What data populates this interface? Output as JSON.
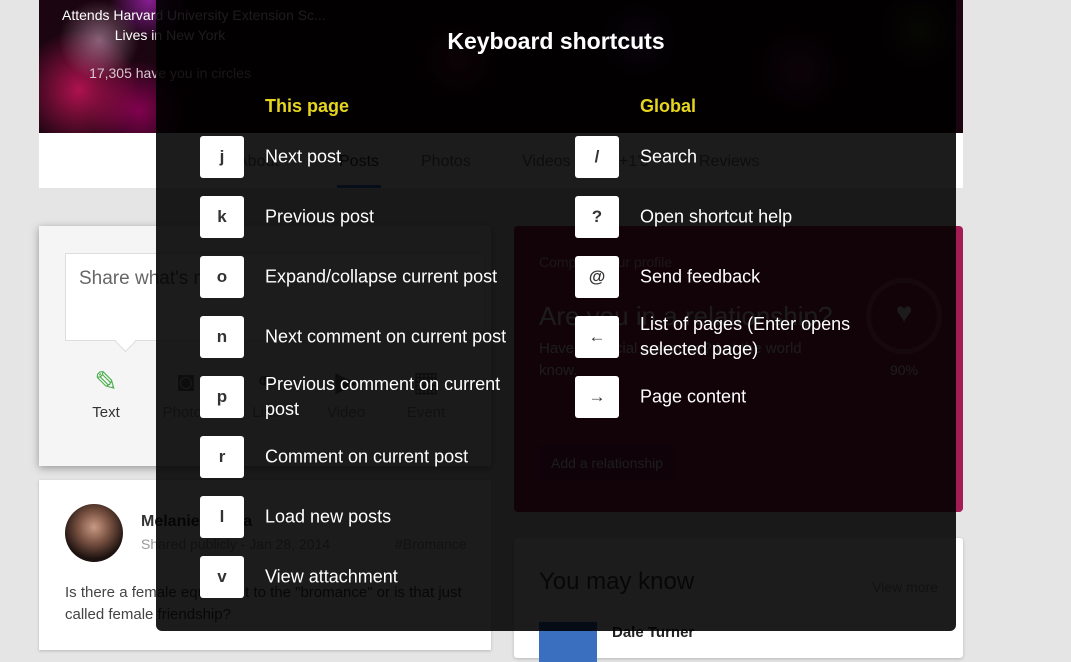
{
  "profile": {
    "school": "Attends Harvard University Extension Sc...",
    "location": "Lives in New York",
    "circles": "17,305 have you in circles",
    "tabs": [
      {
        "label": "About"
      },
      {
        "label": "Posts",
        "active": true
      },
      {
        "label": "Photos"
      },
      {
        "label": "Videos"
      },
      {
        "label": "+1's"
      },
      {
        "label": "Reviews"
      }
    ]
  },
  "share": {
    "placeholder": "Share what's new...",
    "actions": [
      {
        "label": "Text",
        "icon": "pencil-icon",
        "active": true
      },
      {
        "label": "Photos",
        "icon": "camera-icon"
      },
      {
        "label": "Link",
        "icon": "link-icon"
      },
      {
        "label": "Video",
        "icon": "video-icon"
      },
      {
        "label": "Event",
        "icon": "calendar-icon"
      }
    ]
  },
  "post": {
    "author": "Melanie Pinola",
    "visibility": "Shared publicly",
    "separator": "-",
    "date": "Jan 28, 2014",
    "hashtag": "#Bromance",
    "body": "Is there a female equivalent to the \"bromance\" or is that just called female friendship?"
  },
  "profile_card": {
    "label": "Complete your profile",
    "question": "Are you in a relationship?",
    "subtext": "Have a special someone? Let the world know.",
    "progress_percent": 90,
    "progress_label": "90%",
    "button": "Add a relationship",
    "accent_color": "#a51c55"
  },
  "you_may_know": {
    "title": "You may know",
    "view_more": "View more",
    "first_person": "Dale Turner"
  },
  "shortcuts": {
    "title": "Keyboard shortcuts",
    "header_color": "#e6d51f",
    "this_page": {
      "heading": "This page",
      "items": [
        {
          "key": "j",
          "desc": "Next post"
        },
        {
          "key": "k",
          "desc": "Previous post"
        },
        {
          "key": "o",
          "desc": "Expand/collapse current post"
        },
        {
          "key": "n",
          "desc": "Next comment on current post"
        },
        {
          "key": "p",
          "desc": "Previous comment on current post"
        },
        {
          "key": "r",
          "desc": "Comment on current post"
        },
        {
          "key": "l",
          "desc": "Load new posts"
        },
        {
          "key": "v",
          "desc": "View attachment"
        }
      ]
    },
    "global": {
      "heading": "Global",
      "items": [
        {
          "key": "/",
          "desc": "Search"
        },
        {
          "key": "?",
          "desc": "Open shortcut help"
        },
        {
          "key": "@",
          "desc": "Send feedback"
        },
        {
          "key": "←",
          "desc": "List of pages (Enter opens selected page)"
        },
        {
          "key": "→",
          "desc": "Page content"
        }
      ]
    }
  }
}
